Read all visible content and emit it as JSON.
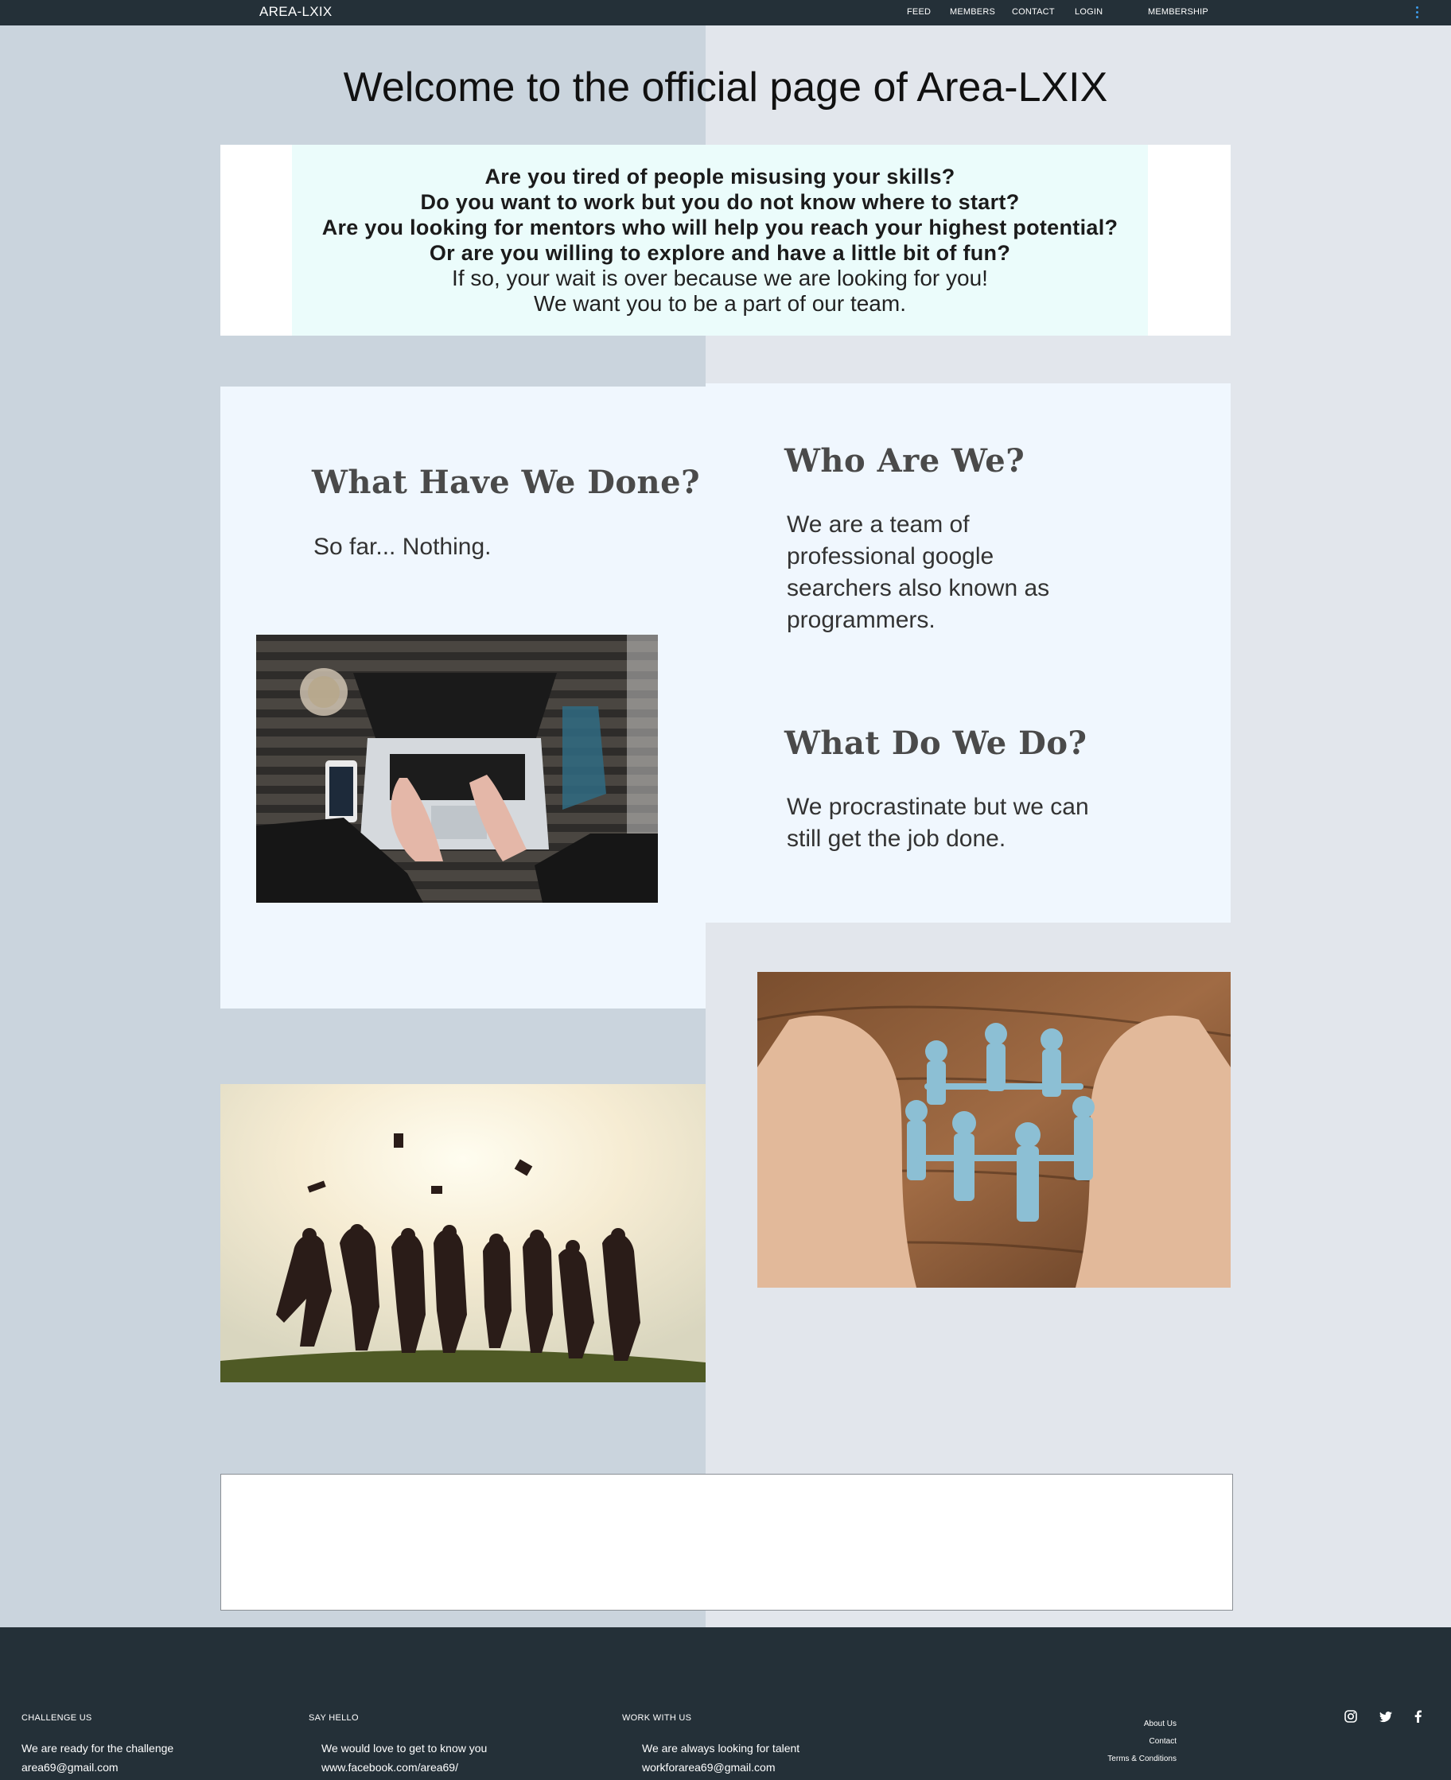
{
  "nav": {
    "brand": "AREA-LXIX",
    "links": [
      "FEED",
      "MEMBERS",
      "CONTACT",
      "LOGIN",
      "MEMBERSHIP"
    ],
    "more_icon": "vertical-dots-icon",
    "more_color": "#3d9be9"
  },
  "title": "Welcome to the official page of Area-LXIX",
  "intro": {
    "questions": [
      "Are you tired of people misusing your skills?",
      "Do you want to work but you do not know where to start?",
      "Are you looking for mentors who will help you reach your highest potential?",
      "Or are you willing to explore and have a little bit of fun?"
    ],
    "lines": [
      "If so, your wait is over because we are looking for you!",
      "We want you to be a part of our team."
    ]
  },
  "sections": {
    "done": {
      "heading": "What Have We Done?",
      "text": "So far... Nothing."
    },
    "who": {
      "heading": "Who Are We?",
      "text": "We are a team of professional google searchers also known as programmers."
    },
    "do": {
      "heading": "What Do We Do?",
      "text": "We procrastinate but we can still get the job done."
    }
  },
  "images": {
    "laptop": "laptop-typing-photo",
    "circle": "hands-paper-people-circle-photo",
    "grads": "graduates-jumping-photo"
  },
  "footer": {
    "challenge": {
      "heading": "CHALLENGE US",
      "text": "We are ready for the challenge",
      "contact": "area69@gmail.com"
    },
    "hello": {
      "heading": "SAY HELLO",
      "text": "We would love to get to know you",
      "contact": "www.facebook.com/area69/"
    },
    "work": {
      "heading": "WORK WITH US",
      "text": "We are always looking for talent",
      "contact": "workforarea69@gmail.com"
    },
    "links": [
      "About Us",
      "Contact",
      "Terms & Conditions"
    ],
    "social": [
      "instagram-icon",
      "twitter-icon",
      "facebook-icon"
    ]
  },
  "colors": {
    "nav_bg": "#243038",
    "left_bg": "#cad4dd",
    "right_bg": "#e2e6ec",
    "panel_bg": "#f0f7fe",
    "intro_bg": "#ebfcfb"
  }
}
